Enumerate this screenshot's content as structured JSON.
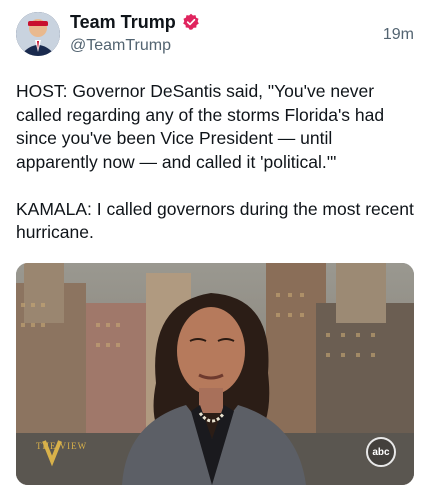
{
  "author": {
    "display_name": "Team Trump",
    "handle": "@TeamTrump",
    "verified_icon": "verified-badge-icon",
    "avatar_icon": "avatar-icon"
  },
  "post": {
    "timestamp": "19m",
    "text": "HOST: Governor DeSantis said, \"You've never called regarding any of the storms Florida's had since you've been Vice President — until apparently now — and called it 'political.'\"\n\nKAMALA: I called governors during the most recent hurricane."
  },
  "media": {
    "show_logo_text": "THE VIEW",
    "network_logo_text": "abc"
  },
  "colors": {
    "verified_badge": "#e0245e",
    "handle": "#536471",
    "text": "#0f1419",
    "background": "#ffffff"
  }
}
